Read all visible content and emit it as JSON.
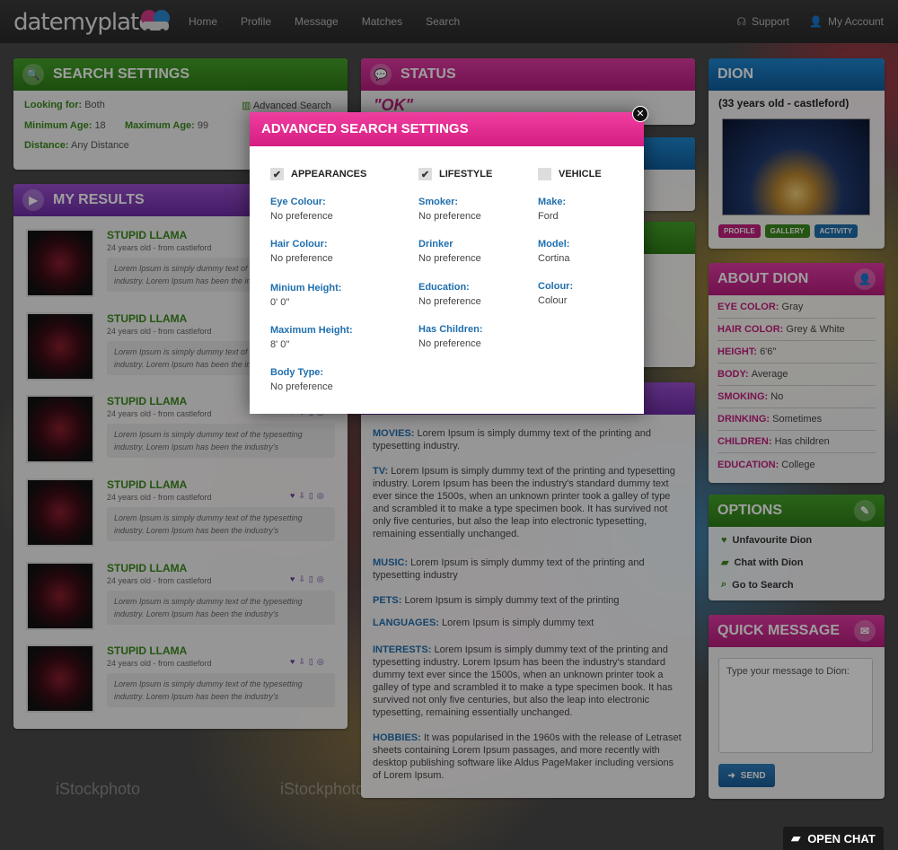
{
  "header": {
    "logo": "datemyplate",
    "nav": [
      "Home",
      "Profile",
      "Message",
      "Matches",
      "Search"
    ],
    "support": "Support",
    "account": "My Account"
  },
  "search_settings": {
    "title": "SEARCH SETTINGS",
    "looking_for_label": "Looking for:",
    "looking_for": "Both",
    "min_age_label": "Minimum Age:",
    "min_age": "18",
    "max_age_label": "Maximum Age:",
    "max_age": "99",
    "distance_label": "Distance:",
    "distance": "Any Distance",
    "advanced": "Advanced Search"
  },
  "status": {
    "title": "STATUS",
    "text": "\"OK\""
  },
  "results": {
    "title": "MY RESULTS",
    "items": [
      {
        "name": "STUPID LLAMA",
        "sub": "24 years old - from castleford",
        "text": "Lorem Ipsum is simply dummy text of the typesetting industry. Lorem Ipsum has been the industry's"
      },
      {
        "name": "STUPID LLAMA",
        "sub": "24 years old - from castleford",
        "text": "Lorem Ipsum is simply dummy text of the typesetting industry. Lorem Ipsum has been the industry's"
      },
      {
        "name": "STUPID LLAMA",
        "sub": "24 years old - from castleford",
        "text": "Lorem Ipsum is simply dummy text of the typesetting industry. Lorem Ipsum has been the industry's"
      },
      {
        "name": "STUPID LLAMA",
        "sub": "24 years old - from castleford",
        "text": "Lorem Ipsum is simply dummy text of the typesetting industry. Lorem Ipsum has been the industry's"
      },
      {
        "name": "STUPID LLAMA",
        "sub": "24 years old - from castleford",
        "text": "Lorem Ipsum is simply dummy text of the typesetting industry. Lorem Ipsum has been the industry's"
      },
      {
        "name": "STUPID LLAMA",
        "sub": "24 years old - from castleford",
        "text": "Lorem Ipsum is simply dummy text of the typesetting industry. Lorem Ipsum has been the industry's"
      }
    ]
  },
  "interests": {
    "movies_l": "MOVIES:",
    "movies": "Lorem Ipsum is simply dummy text of the printing and typesetting industry.",
    "tv_l": "TV:",
    "tv": "Lorem Ipsum is simply dummy text of the printing and typesetting industry. Lorem Ipsum has been the industry's standard dummy text ever since the 1500s, when an unknown printer took a galley of type and scrambled it to make a type specimen book. It has survived not only five centuries, but also the leap into electronic typesetting, remaining essentially unchanged.",
    "music_l": "MUSIC:",
    "music": "Lorem Ipsum is simply dummy text of the printing and typesetting industry",
    "pets_l": "PETS:",
    "pets": "Lorem Ipsum is simply dummy text of the printing",
    "lang_l": "LANGUAGES:",
    "lang": "Lorem Ipsum is simply dummy text",
    "int_l": "INTERESTS:",
    "int": "Lorem Ipsum is simply dummy text of the printing and typesetting industry. Lorem Ipsum has been the industry's standard dummy text ever since the 1500s, when an unknown printer took a galley of type and scrambled it to make a type specimen book. It has survived not only five centuries, but also the leap into electronic typesetting, remaining essentially unchanged.",
    "hob_l": "HOBBIES:",
    "hob": "It was popularised in the 1960s with the release of Letraset sheets containing Lorem Ipsum passages, and more recently with desktop publishing software like Aldus PageMaker including versions of Lorem Ipsum."
  },
  "profile": {
    "name": "DION",
    "sub": "(33 years old - castleford)",
    "tabs": [
      "PROFILE",
      "GALLERY",
      "ACTIVITY"
    ]
  },
  "about": {
    "title": "ABOUT DION",
    "rows": [
      {
        "k": "EYE COLOR:",
        "v": "Gray"
      },
      {
        "k": "HAIR COLOR:",
        "v": "Grey & White"
      },
      {
        "k": "HEIGHT:",
        "v": "6'6\""
      },
      {
        "k": "BODY:",
        "v": "Average"
      },
      {
        "k": "SMOKING:",
        "v": "No"
      },
      {
        "k": "DRINKING:",
        "v": "Sometimes"
      },
      {
        "k": "CHILDREN:",
        "v": "Has children"
      },
      {
        "k": "EDUCATION:",
        "v": "College"
      }
    ]
  },
  "options": {
    "title": "OPTIONS",
    "items": [
      "Unfavourite Dion",
      "Chat with Dion",
      "Go to Search"
    ]
  },
  "quick": {
    "title": "QUICK MESSAGE",
    "placeholder": "Type your message to Dion:",
    "send": "SEND"
  },
  "openchat": "OPEN CHAT",
  "watermark": "iStockphoto",
  "modal": {
    "title": "ADVANCED SEARCH SETTINGS",
    "appearances": {
      "label": "APPEARANCES",
      "checked": true,
      "fields": [
        {
          "l": "Eye Colour:",
          "v": "No preference"
        },
        {
          "l": "Hair Colour:",
          "v": "No preference"
        },
        {
          "l": "Minium Height:",
          "v": "0' 0\""
        },
        {
          "l": "Maximum Height:",
          "v": "8' 0\""
        },
        {
          "l": "Body Type:",
          "v": "No preference"
        }
      ]
    },
    "lifestyle": {
      "label": "LIFESTYLE",
      "checked": true,
      "fields": [
        {
          "l": "Smoker:",
          "v": "No preference"
        },
        {
          "l": "Drinker",
          "v": "No preference"
        },
        {
          "l": "Education:",
          "v": "No preference"
        },
        {
          "l": "Has Children:",
          "v": "No preference"
        }
      ]
    },
    "vehicle": {
      "label": "VEHICLE",
      "checked": false,
      "fields": [
        {
          "l": "Make:",
          "v": "Ford"
        },
        {
          "l": "Model:",
          "v": "Cortina"
        },
        {
          "l": "Colour:",
          "v": "Colour"
        }
      ]
    }
  }
}
